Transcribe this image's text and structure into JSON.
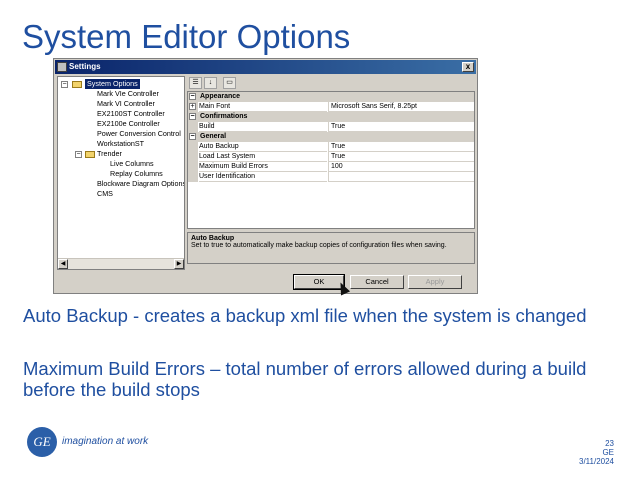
{
  "slide": {
    "title": "System Editor Options",
    "paragraph1": "Auto Backup - creates a backup xml file when the system is changed",
    "paragraph2": "Maximum Build Errors – total number of errors allowed during a build before the build stops",
    "tagline": "imagination at work",
    "logo_text": "GE",
    "page_number": "23",
    "company": "GE",
    "date": "3/11/2024"
  },
  "window": {
    "title": "Settings",
    "close_label": "x"
  },
  "tree": {
    "items": [
      {
        "label": "System Options"
      },
      {
        "label": "Mark VIe Controller"
      },
      {
        "label": "Mark VI Controller"
      },
      {
        "label": "EX2100ST Controller"
      },
      {
        "label": "EX2100e Controller"
      },
      {
        "label": "Power Conversion Control"
      },
      {
        "label": "WorkstationST"
      },
      {
        "label": "Trender"
      },
      {
        "label": "Live Columns"
      },
      {
        "label": "Replay Columns"
      },
      {
        "label": "Blockware Diagram Options"
      },
      {
        "label": "CMS"
      }
    ]
  },
  "toolbar": {
    "categorized_icon": "categorized-icon",
    "alphabetical_icon": "alphabetical-icon",
    "property_pages_icon": "property-pages-icon"
  },
  "grid": {
    "rows": [
      {
        "type": "category",
        "label": "Appearance"
      },
      {
        "type": "property",
        "name": "Main Font",
        "value": "Microsoft Sans Serif, 8.25pt"
      },
      {
        "type": "category",
        "label": "Confirmations"
      },
      {
        "type": "property",
        "name": "Build",
        "value": "True"
      },
      {
        "type": "category",
        "label": "General"
      },
      {
        "type": "property",
        "name": "Auto Backup",
        "value": "True"
      },
      {
        "type": "property",
        "name": "Load Last System",
        "value": "True"
      },
      {
        "type": "property",
        "name": "Maximum Build Errors",
        "value": "100"
      },
      {
        "type": "property",
        "name": "User Identification",
        "value": ""
      }
    ]
  },
  "description": {
    "title": "Auto Backup",
    "text": "Set to true to automatically make backup copies of configuration files when saving."
  },
  "buttons": {
    "ok": "OK",
    "cancel": "Cancel",
    "apply": "Apply"
  },
  "colors": {
    "title_blue": "#1f4fa0",
    "selection": "#0a246a",
    "dialog_bg": "#d4d0c8"
  }
}
